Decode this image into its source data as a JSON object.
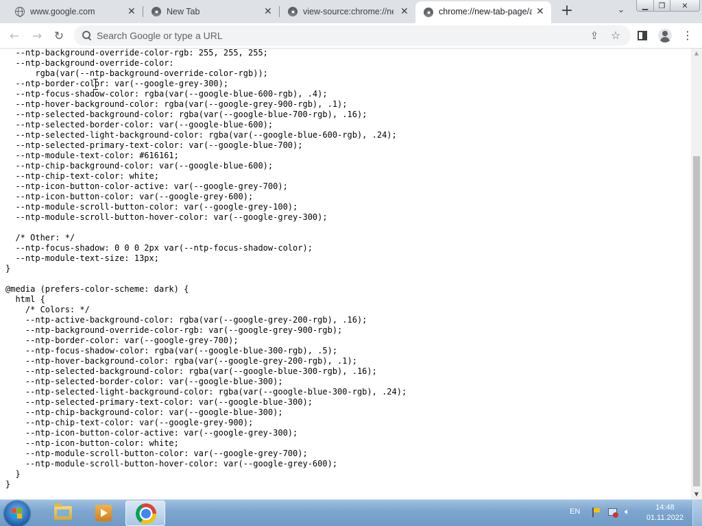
{
  "tabs": [
    {
      "title": "www.google.com",
      "icon": "globe-icon",
      "active": false
    },
    {
      "title": "New Tab",
      "icon": "chrome-icon",
      "active": false
    },
    {
      "title": "view-source:chrome://new",
      "icon": "chrome-icon",
      "active": false
    },
    {
      "title": "chrome://new-tab-page/a",
      "icon": "chrome-icon",
      "active": true
    }
  ],
  "toolbar": {
    "omnibox_placeholder": "Search Google or type a URL"
  },
  "source_lines": [
    "  --ntp-background-override-color-rgb: 255, 255, 255;",
    "  --ntp-background-override-color:",
    "      rgba(var(--ntp-background-override-color-rgb));",
    "  --ntp-border-color: var(--google-grey-300);",
    "  --ntp-focus-shadow-color: rgba(var(--google-blue-600-rgb), .4);",
    "  --ntp-hover-background-color: rgba(var(--google-grey-900-rgb), .1);",
    "  --ntp-selected-background-color: rgba(var(--google-blue-700-rgb), .16);",
    "  --ntp-selected-border-color: var(--google-blue-600);",
    "  --ntp-selected-light-background-color: rgba(var(--google-blue-600-rgb), .24);",
    "  --ntp-selected-primary-text-color: var(--google-blue-700);",
    "  --ntp-module-text-color: #616161;",
    "  --ntp-chip-background-color: var(--google-blue-600);",
    "  --ntp-chip-text-color: white;",
    "  --ntp-icon-button-color-active: var(--google-grey-700);",
    "  --ntp-icon-button-color: var(--google-grey-600);",
    "  --ntp-module-scroll-button-color: var(--google-grey-100);",
    "  --ntp-module-scroll-button-hover-color: var(--google-grey-300);",
    "",
    "  /* Other: */",
    "  --ntp-focus-shadow: 0 0 0 2px var(--ntp-focus-shadow-color);",
    "  --ntp-module-text-size: 13px;",
    "}",
    "",
    "@media (prefers-color-scheme: dark) {",
    "  html {",
    "    /* Colors: */",
    "    --ntp-active-background-color: rgba(var(--google-grey-200-rgb), .16);",
    "    --ntp-background-override-color-rgb: var(--google-grey-900-rgb);",
    "    --ntp-border-color: var(--google-grey-700);",
    "    --ntp-focus-shadow-color: rgba(var(--google-blue-300-rgb), .5);",
    "    --ntp-hover-background-color: rgba(var(--google-grey-200-rgb), .1);",
    "    --ntp-selected-background-color: rgba(var(--google-blue-300-rgb), .16);",
    "    --ntp-selected-border-color: var(--google-blue-300);",
    "    --ntp-selected-light-background-color: rgba(var(--google-blue-300-rgb), .24);",
    "    --ntp-selected-primary-text-color: var(--google-blue-300);",
    "    --ntp-chip-background-color: var(--google-blue-300);",
    "    --ntp-chip-text-color: var(--google-grey-900);",
    "    --ntp-icon-button-color-active: var(--google-grey-300);",
    "    --ntp-icon-button-color: white;",
    "    --ntp-module-scroll-button-color: var(--google-grey-700);",
    "    --ntp-module-scroll-button-hover-color: var(--google-grey-600);",
    "  }",
    "}"
  ],
  "taskbar": {
    "items": [
      {
        "name": "windows-explorer",
        "icon": "folder-icon",
        "active": false
      },
      {
        "name": "media-player",
        "icon": "media-player-icon",
        "active": false
      },
      {
        "name": "google-chrome",
        "icon": "chrome-icon",
        "active": true
      }
    ],
    "language": "EN",
    "time": "14:48",
    "date": "01.11.2022"
  },
  "colors": {
    "tabstrip_bg": "#dee1e6",
    "toolbar_bg": "#ffffff",
    "omnibox_bg": "#f1f3f4",
    "taskbar_bg": "#7fa7cf"
  }
}
